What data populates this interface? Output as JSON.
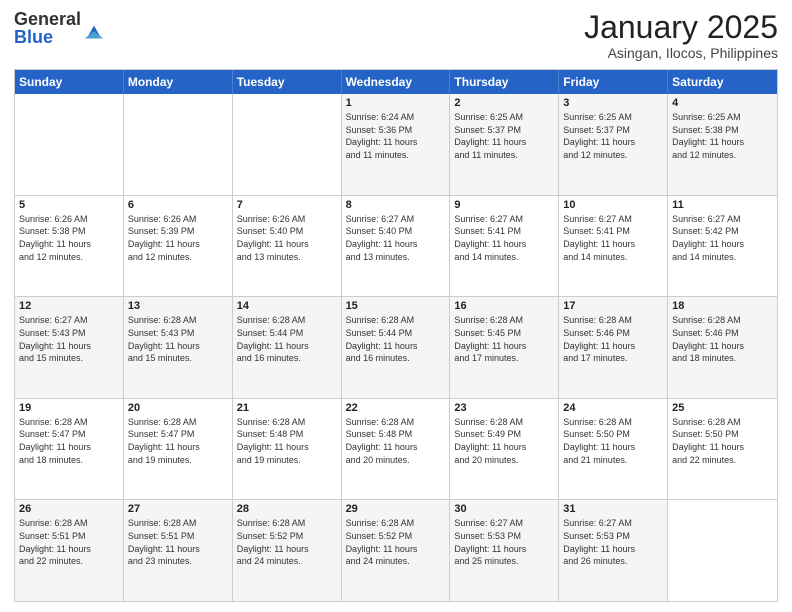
{
  "header": {
    "logo_general": "General",
    "logo_blue": "Blue",
    "month": "January 2025",
    "location": "Asingan, Ilocos, Philippines"
  },
  "weekdays": [
    "Sunday",
    "Monday",
    "Tuesday",
    "Wednesday",
    "Thursday",
    "Friday",
    "Saturday"
  ],
  "rows": [
    [
      {
        "day": "",
        "info": ""
      },
      {
        "day": "",
        "info": ""
      },
      {
        "day": "",
        "info": ""
      },
      {
        "day": "1",
        "info": "Sunrise: 6:24 AM\nSunset: 5:36 PM\nDaylight: 11 hours\nand 11 minutes."
      },
      {
        "day": "2",
        "info": "Sunrise: 6:25 AM\nSunset: 5:37 PM\nDaylight: 11 hours\nand 11 minutes."
      },
      {
        "day": "3",
        "info": "Sunrise: 6:25 AM\nSunset: 5:37 PM\nDaylight: 11 hours\nand 12 minutes."
      },
      {
        "day": "4",
        "info": "Sunrise: 6:25 AM\nSunset: 5:38 PM\nDaylight: 11 hours\nand 12 minutes."
      }
    ],
    [
      {
        "day": "5",
        "info": "Sunrise: 6:26 AM\nSunset: 5:38 PM\nDaylight: 11 hours\nand 12 minutes."
      },
      {
        "day": "6",
        "info": "Sunrise: 6:26 AM\nSunset: 5:39 PM\nDaylight: 11 hours\nand 12 minutes."
      },
      {
        "day": "7",
        "info": "Sunrise: 6:26 AM\nSunset: 5:40 PM\nDaylight: 11 hours\nand 13 minutes."
      },
      {
        "day": "8",
        "info": "Sunrise: 6:27 AM\nSunset: 5:40 PM\nDaylight: 11 hours\nand 13 minutes."
      },
      {
        "day": "9",
        "info": "Sunrise: 6:27 AM\nSunset: 5:41 PM\nDaylight: 11 hours\nand 14 minutes."
      },
      {
        "day": "10",
        "info": "Sunrise: 6:27 AM\nSunset: 5:41 PM\nDaylight: 11 hours\nand 14 minutes."
      },
      {
        "day": "11",
        "info": "Sunrise: 6:27 AM\nSunset: 5:42 PM\nDaylight: 11 hours\nand 14 minutes."
      }
    ],
    [
      {
        "day": "12",
        "info": "Sunrise: 6:27 AM\nSunset: 5:43 PM\nDaylight: 11 hours\nand 15 minutes."
      },
      {
        "day": "13",
        "info": "Sunrise: 6:28 AM\nSunset: 5:43 PM\nDaylight: 11 hours\nand 15 minutes."
      },
      {
        "day": "14",
        "info": "Sunrise: 6:28 AM\nSunset: 5:44 PM\nDaylight: 11 hours\nand 16 minutes."
      },
      {
        "day": "15",
        "info": "Sunrise: 6:28 AM\nSunset: 5:44 PM\nDaylight: 11 hours\nand 16 minutes."
      },
      {
        "day": "16",
        "info": "Sunrise: 6:28 AM\nSunset: 5:45 PM\nDaylight: 11 hours\nand 17 minutes."
      },
      {
        "day": "17",
        "info": "Sunrise: 6:28 AM\nSunset: 5:46 PM\nDaylight: 11 hours\nand 17 minutes."
      },
      {
        "day": "18",
        "info": "Sunrise: 6:28 AM\nSunset: 5:46 PM\nDaylight: 11 hours\nand 18 minutes."
      }
    ],
    [
      {
        "day": "19",
        "info": "Sunrise: 6:28 AM\nSunset: 5:47 PM\nDaylight: 11 hours\nand 18 minutes."
      },
      {
        "day": "20",
        "info": "Sunrise: 6:28 AM\nSunset: 5:47 PM\nDaylight: 11 hours\nand 19 minutes."
      },
      {
        "day": "21",
        "info": "Sunrise: 6:28 AM\nSunset: 5:48 PM\nDaylight: 11 hours\nand 19 minutes."
      },
      {
        "day": "22",
        "info": "Sunrise: 6:28 AM\nSunset: 5:48 PM\nDaylight: 11 hours\nand 20 minutes."
      },
      {
        "day": "23",
        "info": "Sunrise: 6:28 AM\nSunset: 5:49 PM\nDaylight: 11 hours\nand 20 minutes."
      },
      {
        "day": "24",
        "info": "Sunrise: 6:28 AM\nSunset: 5:50 PM\nDaylight: 11 hours\nand 21 minutes."
      },
      {
        "day": "25",
        "info": "Sunrise: 6:28 AM\nSunset: 5:50 PM\nDaylight: 11 hours\nand 22 minutes."
      }
    ],
    [
      {
        "day": "26",
        "info": "Sunrise: 6:28 AM\nSunset: 5:51 PM\nDaylight: 11 hours\nand 22 minutes."
      },
      {
        "day": "27",
        "info": "Sunrise: 6:28 AM\nSunset: 5:51 PM\nDaylight: 11 hours\nand 23 minutes."
      },
      {
        "day": "28",
        "info": "Sunrise: 6:28 AM\nSunset: 5:52 PM\nDaylight: 11 hours\nand 24 minutes."
      },
      {
        "day": "29",
        "info": "Sunrise: 6:28 AM\nSunset: 5:52 PM\nDaylight: 11 hours\nand 24 minutes."
      },
      {
        "day": "30",
        "info": "Sunrise: 6:27 AM\nSunset: 5:53 PM\nDaylight: 11 hours\nand 25 minutes."
      },
      {
        "day": "31",
        "info": "Sunrise: 6:27 AM\nSunset: 5:53 PM\nDaylight: 11 hours\nand 26 minutes."
      },
      {
        "day": "",
        "info": ""
      }
    ]
  ]
}
